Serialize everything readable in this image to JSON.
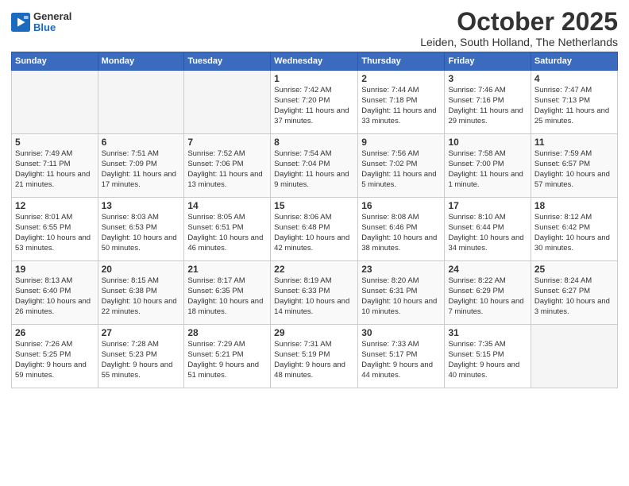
{
  "logo": {
    "general": "General",
    "blue": "Blue"
  },
  "header": {
    "month": "October 2025",
    "location": "Leiden, South Holland, The Netherlands"
  },
  "weekdays": [
    "Sunday",
    "Monday",
    "Tuesday",
    "Wednesday",
    "Thursday",
    "Friday",
    "Saturday"
  ],
  "weeks": [
    [
      {
        "day": "",
        "sunrise": "",
        "sunset": "",
        "daylight": ""
      },
      {
        "day": "",
        "sunrise": "",
        "sunset": "",
        "daylight": ""
      },
      {
        "day": "",
        "sunrise": "",
        "sunset": "",
        "daylight": ""
      },
      {
        "day": "1",
        "sunrise": "Sunrise: 7:42 AM",
        "sunset": "Sunset: 7:20 PM",
        "daylight": "Daylight: 11 hours and 37 minutes."
      },
      {
        "day": "2",
        "sunrise": "Sunrise: 7:44 AM",
        "sunset": "Sunset: 7:18 PM",
        "daylight": "Daylight: 11 hours and 33 minutes."
      },
      {
        "day": "3",
        "sunrise": "Sunrise: 7:46 AM",
        "sunset": "Sunset: 7:16 PM",
        "daylight": "Daylight: 11 hours and 29 minutes."
      },
      {
        "day": "4",
        "sunrise": "Sunrise: 7:47 AM",
        "sunset": "Sunset: 7:13 PM",
        "daylight": "Daylight: 11 hours and 25 minutes."
      }
    ],
    [
      {
        "day": "5",
        "sunrise": "Sunrise: 7:49 AM",
        "sunset": "Sunset: 7:11 PM",
        "daylight": "Daylight: 11 hours and 21 minutes."
      },
      {
        "day": "6",
        "sunrise": "Sunrise: 7:51 AM",
        "sunset": "Sunset: 7:09 PM",
        "daylight": "Daylight: 11 hours and 17 minutes."
      },
      {
        "day": "7",
        "sunrise": "Sunrise: 7:52 AM",
        "sunset": "Sunset: 7:06 PM",
        "daylight": "Daylight: 11 hours and 13 minutes."
      },
      {
        "day": "8",
        "sunrise": "Sunrise: 7:54 AM",
        "sunset": "Sunset: 7:04 PM",
        "daylight": "Daylight: 11 hours and 9 minutes."
      },
      {
        "day": "9",
        "sunrise": "Sunrise: 7:56 AM",
        "sunset": "Sunset: 7:02 PM",
        "daylight": "Daylight: 11 hours and 5 minutes."
      },
      {
        "day": "10",
        "sunrise": "Sunrise: 7:58 AM",
        "sunset": "Sunset: 7:00 PM",
        "daylight": "Daylight: 11 hours and 1 minute."
      },
      {
        "day": "11",
        "sunrise": "Sunrise: 7:59 AM",
        "sunset": "Sunset: 6:57 PM",
        "daylight": "Daylight: 10 hours and 57 minutes."
      }
    ],
    [
      {
        "day": "12",
        "sunrise": "Sunrise: 8:01 AM",
        "sunset": "Sunset: 6:55 PM",
        "daylight": "Daylight: 10 hours and 53 minutes."
      },
      {
        "day": "13",
        "sunrise": "Sunrise: 8:03 AM",
        "sunset": "Sunset: 6:53 PM",
        "daylight": "Daylight: 10 hours and 50 minutes."
      },
      {
        "day": "14",
        "sunrise": "Sunrise: 8:05 AM",
        "sunset": "Sunset: 6:51 PM",
        "daylight": "Daylight: 10 hours and 46 minutes."
      },
      {
        "day": "15",
        "sunrise": "Sunrise: 8:06 AM",
        "sunset": "Sunset: 6:48 PM",
        "daylight": "Daylight: 10 hours and 42 minutes."
      },
      {
        "day": "16",
        "sunrise": "Sunrise: 8:08 AM",
        "sunset": "Sunset: 6:46 PM",
        "daylight": "Daylight: 10 hours and 38 minutes."
      },
      {
        "day": "17",
        "sunrise": "Sunrise: 8:10 AM",
        "sunset": "Sunset: 6:44 PM",
        "daylight": "Daylight: 10 hours and 34 minutes."
      },
      {
        "day": "18",
        "sunrise": "Sunrise: 8:12 AM",
        "sunset": "Sunset: 6:42 PM",
        "daylight": "Daylight: 10 hours and 30 minutes."
      }
    ],
    [
      {
        "day": "19",
        "sunrise": "Sunrise: 8:13 AM",
        "sunset": "Sunset: 6:40 PM",
        "daylight": "Daylight: 10 hours and 26 minutes."
      },
      {
        "day": "20",
        "sunrise": "Sunrise: 8:15 AM",
        "sunset": "Sunset: 6:38 PM",
        "daylight": "Daylight: 10 hours and 22 minutes."
      },
      {
        "day": "21",
        "sunrise": "Sunrise: 8:17 AM",
        "sunset": "Sunset: 6:35 PM",
        "daylight": "Daylight: 10 hours and 18 minutes."
      },
      {
        "day": "22",
        "sunrise": "Sunrise: 8:19 AM",
        "sunset": "Sunset: 6:33 PM",
        "daylight": "Daylight: 10 hours and 14 minutes."
      },
      {
        "day": "23",
        "sunrise": "Sunrise: 8:20 AM",
        "sunset": "Sunset: 6:31 PM",
        "daylight": "Daylight: 10 hours and 10 minutes."
      },
      {
        "day": "24",
        "sunrise": "Sunrise: 8:22 AM",
        "sunset": "Sunset: 6:29 PM",
        "daylight": "Daylight: 10 hours and 7 minutes."
      },
      {
        "day": "25",
        "sunrise": "Sunrise: 8:24 AM",
        "sunset": "Sunset: 6:27 PM",
        "daylight": "Daylight: 10 hours and 3 minutes."
      }
    ],
    [
      {
        "day": "26",
        "sunrise": "Sunrise: 7:26 AM",
        "sunset": "Sunset: 5:25 PM",
        "daylight": "Daylight: 9 hours and 59 minutes."
      },
      {
        "day": "27",
        "sunrise": "Sunrise: 7:28 AM",
        "sunset": "Sunset: 5:23 PM",
        "daylight": "Daylight: 9 hours and 55 minutes."
      },
      {
        "day": "28",
        "sunrise": "Sunrise: 7:29 AM",
        "sunset": "Sunset: 5:21 PM",
        "daylight": "Daylight: 9 hours and 51 minutes."
      },
      {
        "day": "29",
        "sunrise": "Sunrise: 7:31 AM",
        "sunset": "Sunset: 5:19 PM",
        "daylight": "Daylight: 9 hours and 48 minutes."
      },
      {
        "day": "30",
        "sunrise": "Sunrise: 7:33 AM",
        "sunset": "Sunset: 5:17 PM",
        "daylight": "Daylight: 9 hours and 44 minutes."
      },
      {
        "day": "31",
        "sunrise": "Sunrise: 7:35 AM",
        "sunset": "Sunset: 5:15 PM",
        "daylight": "Daylight: 9 hours and 40 minutes."
      },
      {
        "day": "",
        "sunrise": "",
        "sunset": "",
        "daylight": ""
      }
    ]
  ]
}
